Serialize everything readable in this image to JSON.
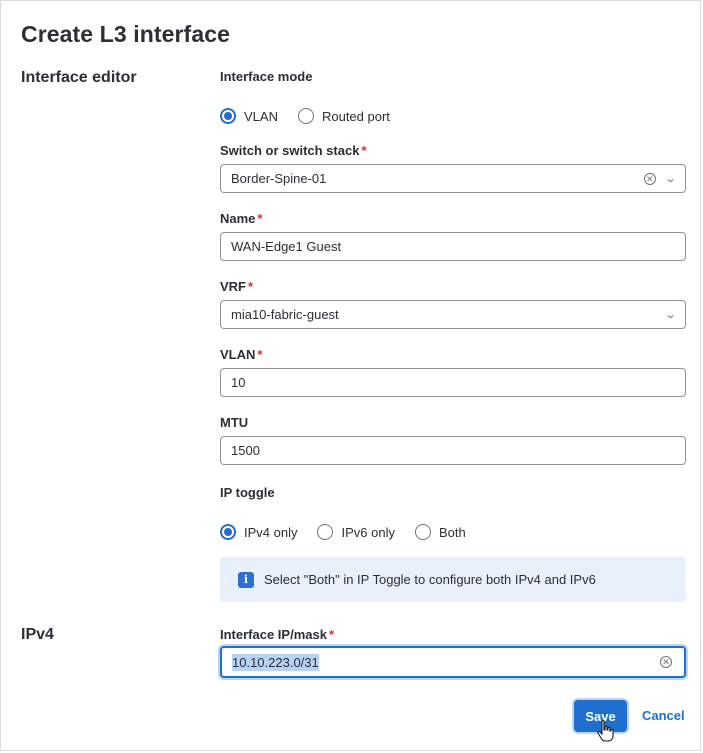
{
  "header": {
    "title": "Create L3 interface"
  },
  "sections": {
    "interface_editor": "Interface editor",
    "ipv4": "IPv4"
  },
  "interface_mode": {
    "label": "Interface mode",
    "options": [
      "VLAN",
      "Routed port"
    ],
    "selected": "VLAN"
  },
  "switch": {
    "label": "Switch or switch stack",
    "required": "*",
    "value": "Border-Spine-01",
    "clear_icon": "clear-circle-icon",
    "dropdown_icon": "chevron-down-icon"
  },
  "name": {
    "label": "Name",
    "required": "*",
    "value": "WAN-Edge1 Guest"
  },
  "vrf": {
    "label": "VRF",
    "required": "*",
    "value": "mia10-fabric-guest",
    "dropdown_icon": "chevron-down-icon"
  },
  "vlan": {
    "label": "VLAN",
    "required": "*",
    "value": "10"
  },
  "mtu": {
    "label": "MTU",
    "value": "1500"
  },
  "ip_toggle": {
    "label": "IP toggle",
    "options": [
      "IPv4 only",
      "IPv6 only",
      "Both"
    ],
    "selected": "IPv4 only"
  },
  "info": {
    "icon": "info-icon",
    "text": "Select \"Both\" in IP Toggle to configure both IPv4 and IPv6"
  },
  "interface_ip": {
    "label": "Interface IP/mask",
    "required": "*",
    "value": "10.10.223.0/31",
    "clear_icon": "clear-circle-icon"
  },
  "actions": {
    "save_label": "Save",
    "cancel_label": "Cancel"
  },
  "colors": {
    "accent": "#1f6fd1",
    "required": "#d3313b",
    "info_bg": "#e8f0fb",
    "text": "#2b2f36"
  }
}
